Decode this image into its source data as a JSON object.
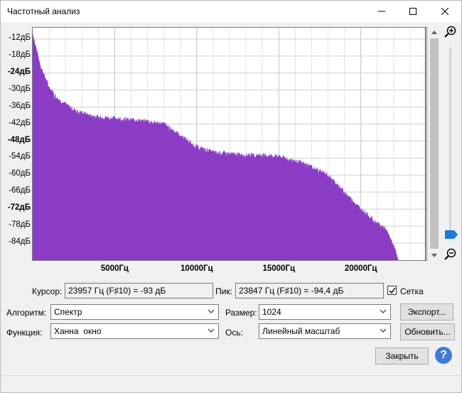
{
  "window": {
    "title": "Частотный анализ"
  },
  "plot": {
    "y_ticks": [
      {
        "label": "-12дБ",
        "bold": false
      },
      {
        "label": "-18дБ",
        "bold": false
      },
      {
        "label": "-24дБ",
        "bold": true
      },
      {
        "label": "-30дБ",
        "bold": false
      },
      {
        "label": "-36дБ",
        "bold": false
      },
      {
        "label": "-42дБ",
        "bold": false
      },
      {
        "label": "-48дБ",
        "bold": true
      },
      {
        "label": "-54дБ",
        "bold": false
      },
      {
        "label": "-60дБ",
        "bold": false
      },
      {
        "label": "-66дБ",
        "bold": false
      },
      {
        "label": "-72дБ",
        "bold": true
      },
      {
        "label": "-78дБ",
        "bold": false
      },
      {
        "label": "-84дБ",
        "bold": false
      }
    ],
    "x_ticks": [
      "5000Гц",
      "10000Гц",
      "15000Гц",
      "20000Гц"
    ]
  },
  "chart_data": {
    "type": "area",
    "x": [
      0,
      200,
      500,
      1000,
      1500,
      2000,
      2500,
      3000,
      3500,
      4000,
      5000,
      6000,
      7000,
      8000,
      9000,
      10000,
      11000,
      12000,
      13000,
      14000,
      15000,
      16000,
      17000,
      18000,
      19000,
      20000,
      21000,
      21500,
      22000,
      22300
    ],
    "y": [
      -10,
      -15,
      -22,
      -29,
      -33,
      -35,
      -37,
      -38,
      -39,
      -39.5,
      -40,
      -40.5,
      -41,
      -42,
      -46,
      -50,
      -52,
      -52.5,
      -53,
      -53,
      -53.5,
      -55,
      -57,
      -60,
      -66,
      -72,
      -77,
      -79,
      -85,
      -90
    ],
    "xlim": [
      0,
      24000
    ],
    "ylim": [
      -90,
      -8
    ],
    "x_ticks": [
      5000,
      10000,
      15000,
      20000
    ],
    "y_ticks": [
      -12,
      -18,
      -24,
      -30,
      -36,
      -42,
      -48,
      -54,
      -60,
      -66,
      -72,
      -78,
      -84
    ],
    "grid": true,
    "color": "#8a3cc4"
  },
  "readouts": {
    "cursor_label": "Курсор:",
    "cursor_value": "23957 Гц (F♯10) = -93 дБ",
    "peak_label": "Пик:",
    "peak_value": "23847 Гц (F♯10) = -94,4 дБ",
    "grid_label": "Сетка",
    "grid_checked": true
  },
  "controls": {
    "algorithm_label": "Алгоритм:",
    "algorithm_value": "Спектр",
    "size_label": "Размер:",
    "size_value": "1024",
    "export_label": "Экспорт...",
    "function_label": "Функция:",
    "function_value": "Ханна  окно",
    "axis_label": "Ось:",
    "axis_value": "Линейный масштаб",
    "refresh_label": "Обновить...",
    "close_label": "Закрыть"
  },
  "colors": {
    "accent": "#8a3cc4",
    "help": "#3e7ad6",
    "slider": "#1c7bd8",
    "cursor": "#c00000"
  }
}
